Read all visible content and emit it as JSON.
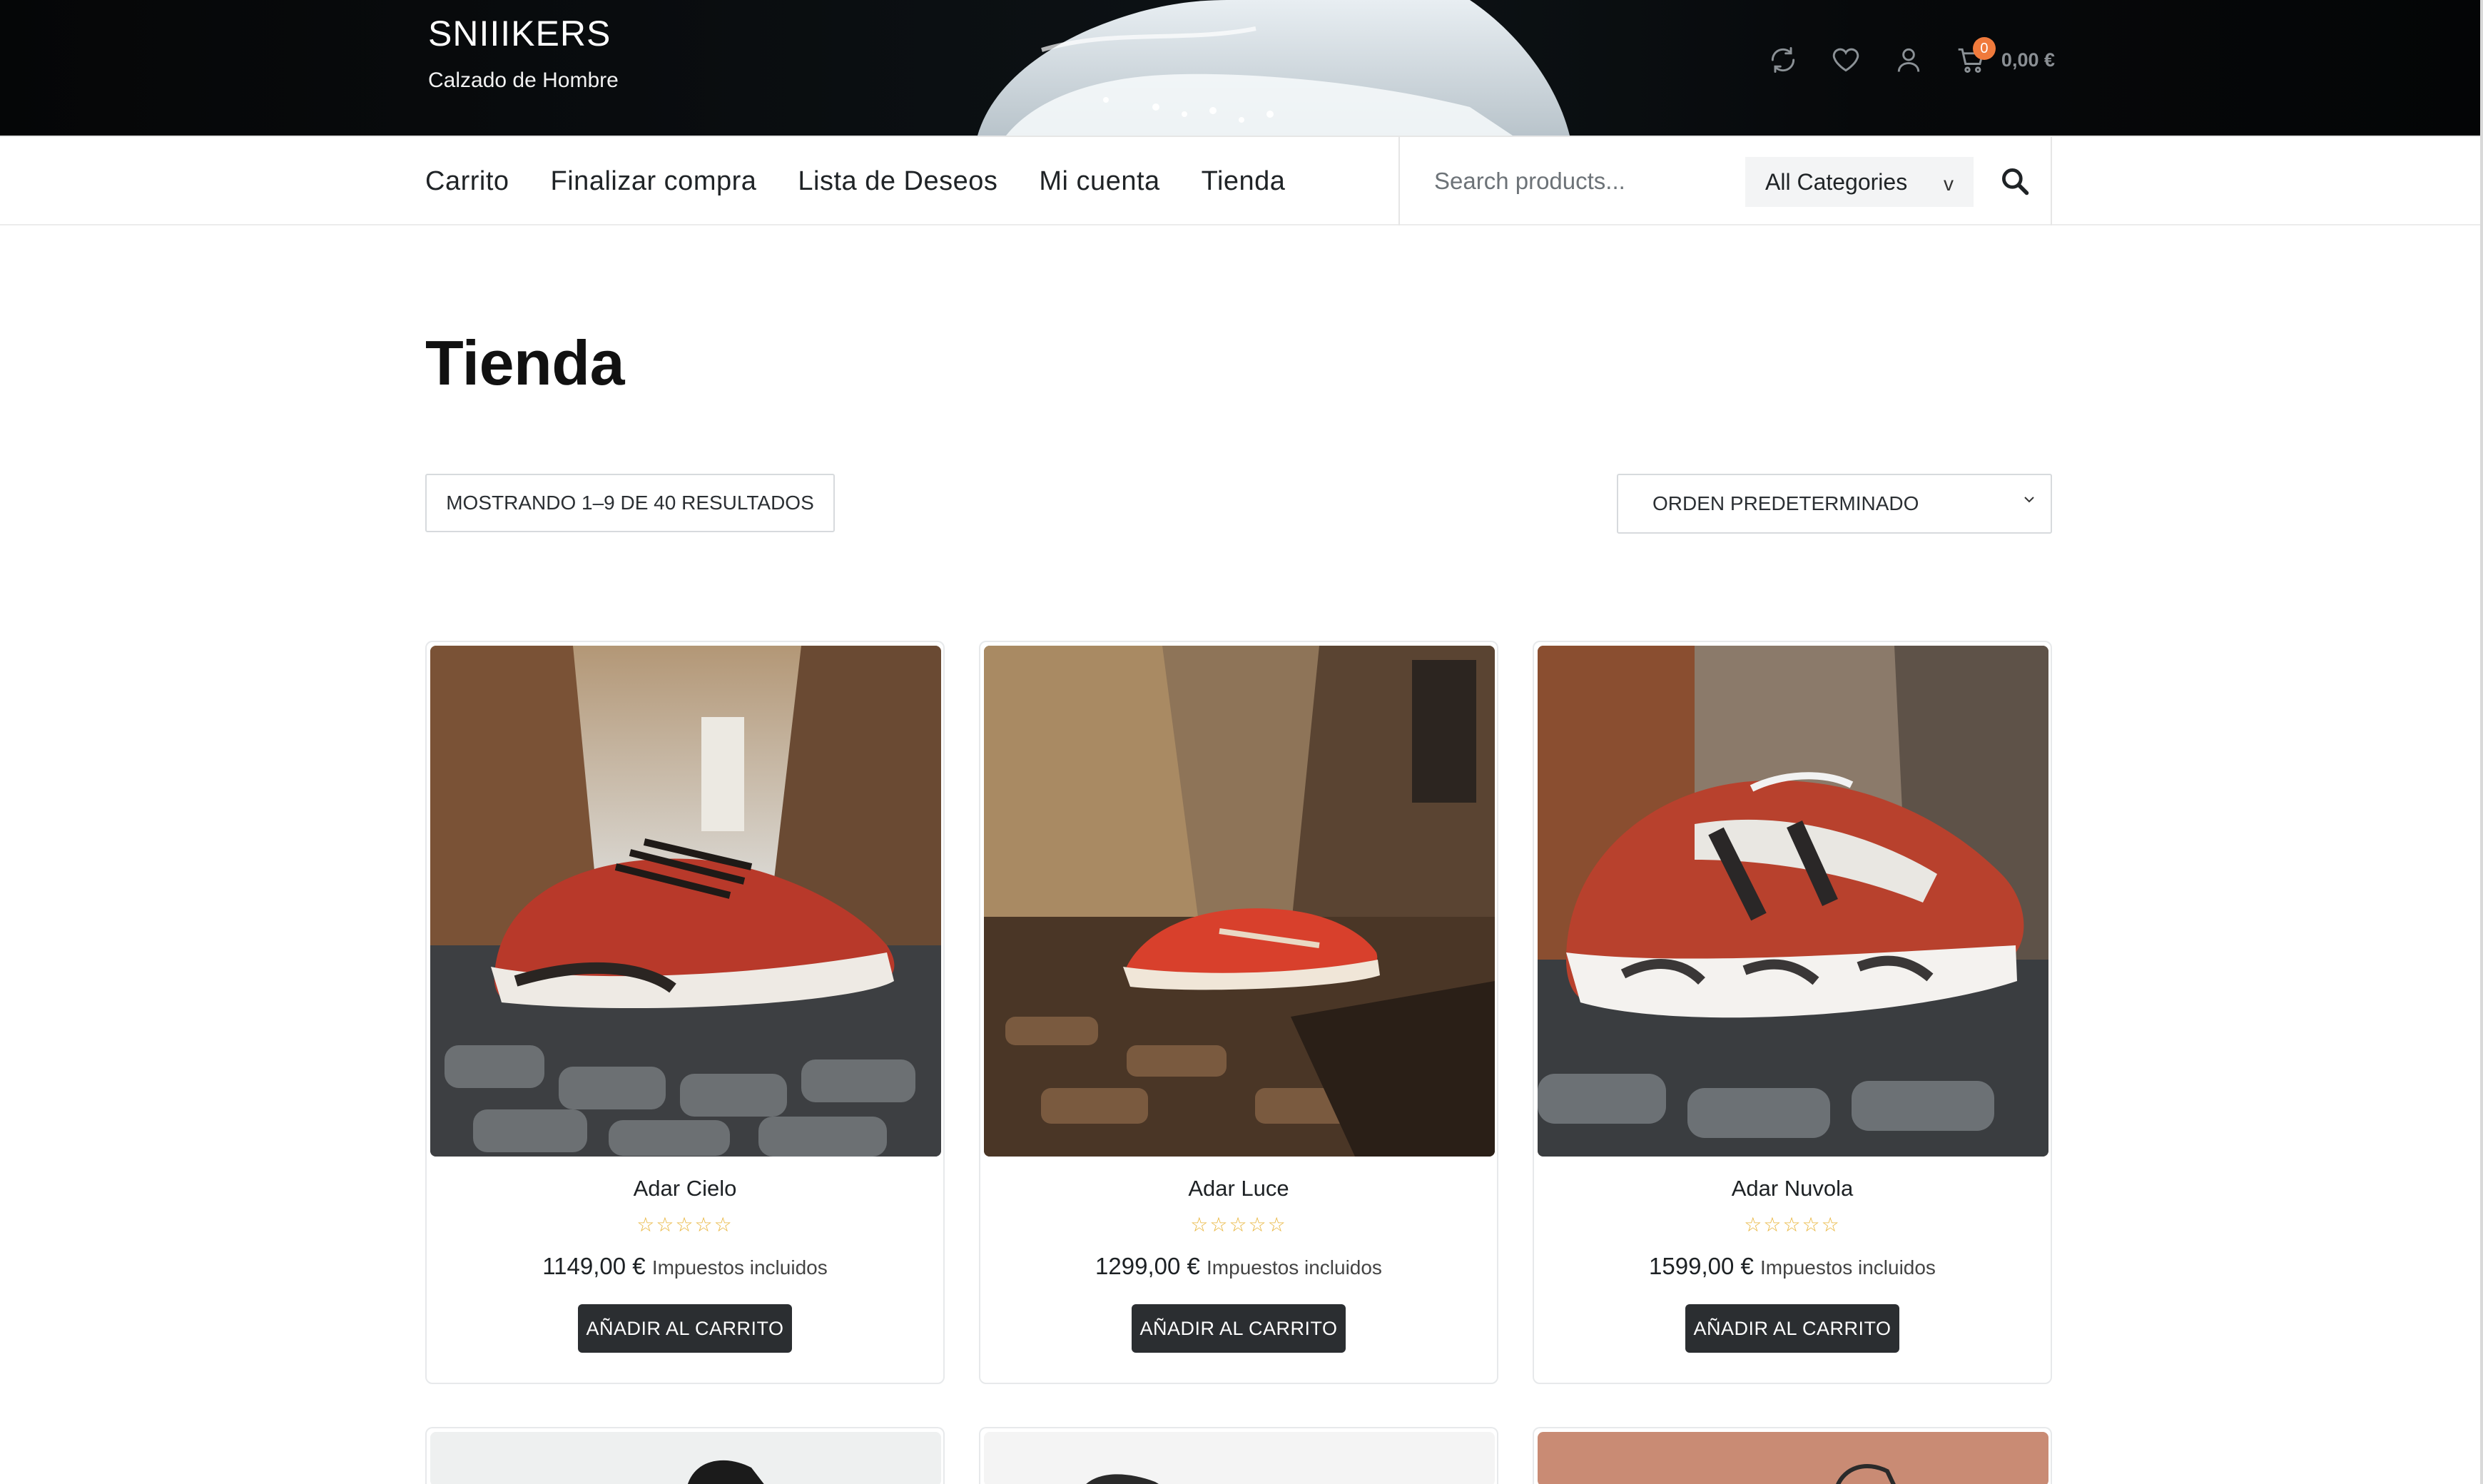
{
  "header": {
    "site_title": "SNIIIKERS",
    "tagline": "Calzado de Hombre",
    "actions": [
      {
        "icon": "refresh-icon"
      },
      {
        "icon": "heart-icon"
      },
      {
        "icon": "user-icon"
      }
    ],
    "cart": {
      "icon": "cart-icon",
      "count": "0",
      "total": "0,00 €"
    },
    "accent_color": "#f07a3c"
  },
  "nav": {
    "items": [
      {
        "label": "Carrito"
      },
      {
        "label": "Finalizar compra"
      },
      {
        "label": "Lista de Deseos"
      },
      {
        "label": "Mi cuenta"
      },
      {
        "label": "Tienda"
      }
    ],
    "search": {
      "placeholder": "Search products...",
      "category_label": "All Categories",
      "category_arrow": "v"
    }
  },
  "main": {
    "title": "Tienda",
    "result_count": "MOSTRANDO 1–9 DE 40 RESULTADOS",
    "orderby": "ORDEN PREDETERMINADO"
  },
  "products": [
    {
      "name": "Adar Cielo",
      "stars": "☆☆☆☆☆",
      "price": "1149,00 €",
      "tax_note": "Impuestos incluidos",
      "button": "AÑADIR AL CARRITO"
    },
    {
      "name": "Adar Luce",
      "stars": "☆☆☆☆☆",
      "price": "1299,00 €",
      "tax_note": "Impuestos incluidos",
      "button": "AÑADIR AL CARRITO"
    },
    {
      "name": "Adar Nuvola",
      "stars": "☆☆☆☆☆",
      "price": "1599,00 €",
      "tax_note": "Impuestos incluidos",
      "button": "AÑADIR AL CARRITO"
    }
  ],
  "button_color": "#2b2e31"
}
